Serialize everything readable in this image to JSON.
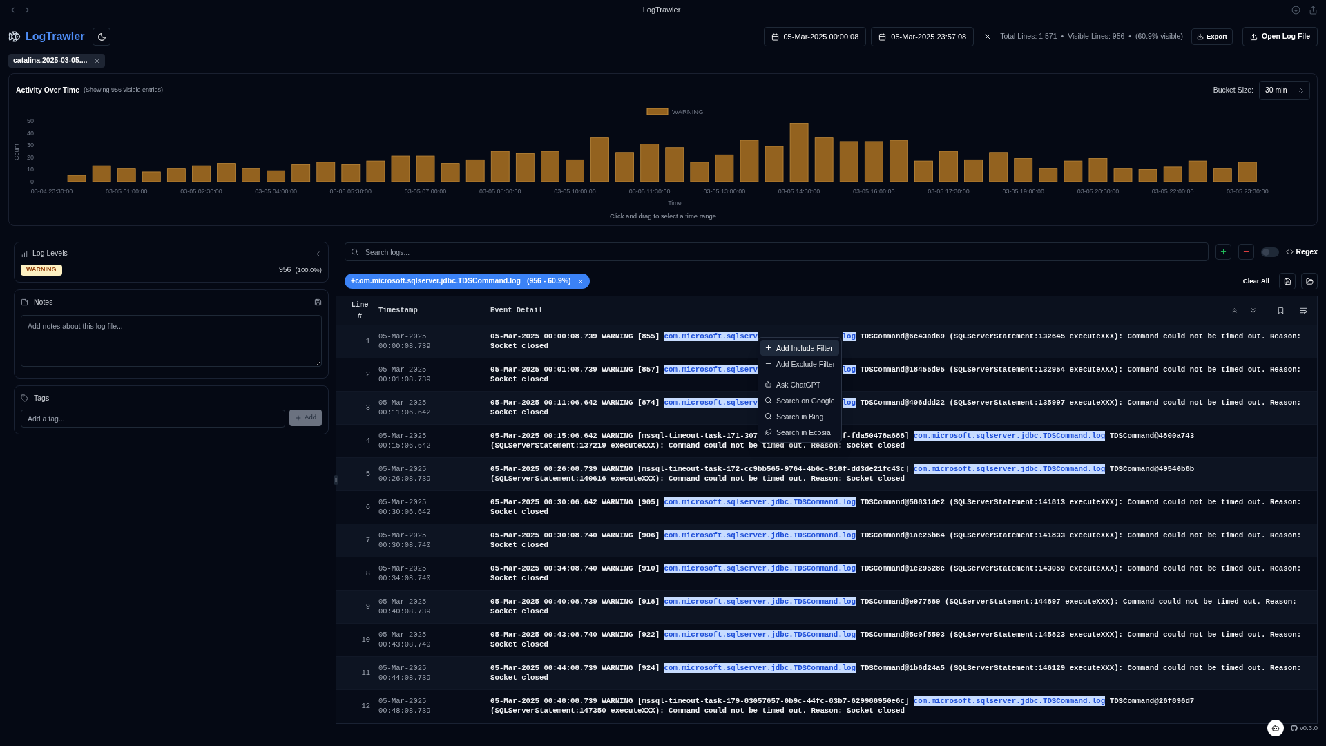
{
  "window": {
    "title": "LogTrawler"
  },
  "header": {
    "app_name": "LogTrawler",
    "start_date": "05-Mar-2025 00:00:08",
    "end_date": "05-Mar-2025 23:57:08",
    "stats": [
      "Total Lines: 1,571",
      "•",
      "Visible Lines: 956",
      "•",
      "(60.9% visible)"
    ],
    "export_label": "Export",
    "open_label": "Open Log File"
  },
  "file_tabs": [
    {
      "label": "catalina.2025-03-05....",
      "selected": true
    }
  ],
  "activity": {
    "title": "Activity Over Time",
    "subtitle": "(Showing 956 visible entries)",
    "bucket_label": "Bucket Size:",
    "bucket_value": "30 min",
    "hint": "Click and drag to select a time range",
    "chart_data": {
      "type": "bar",
      "xlabel": "Time",
      "ylabel": "Count",
      "ylim": [
        0,
        50
      ],
      "yticks": [
        0,
        10,
        20,
        30,
        40,
        50
      ],
      "categories": [
        "03-04 23:30:00",
        null,
        null,
        "03-05 01:00:00",
        null,
        null,
        "03-05 02:30:00",
        null,
        null,
        "03-05 04:00:00",
        null,
        null,
        "03-05 05:30:00",
        null,
        null,
        "03-05 07:00:00",
        null,
        null,
        "03-05 08:30:00",
        null,
        null,
        "03-05 10:00:00",
        null,
        null,
        "03-05 11:30:00",
        null,
        null,
        "03-05 13:00:00",
        null,
        null,
        "03-05 14:30:00",
        null,
        null,
        "03-05 16:00:00",
        null,
        null,
        "03-05 17:30:00",
        null,
        null,
        "03-05 19:00:00",
        null,
        null,
        "03-05 20:30:00",
        null,
        null,
        "03-05 22:00:00",
        null,
        null,
        "03-05 23:30:00"
      ],
      "series": [
        {
          "name": "WARNING",
          "color": "#93621f",
          "values": [
            0,
            5,
            13,
            11,
            8,
            11,
            13,
            15,
            11,
            9,
            14,
            16,
            14,
            17,
            21,
            21,
            15,
            18,
            25,
            23,
            25,
            18,
            36,
            24,
            31,
            28,
            16,
            22,
            34,
            29,
            48,
            36,
            33,
            33,
            34,
            17,
            25,
            18,
            24,
            19,
            11,
            17,
            19,
            11,
            10,
            12,
            17,
            11,
            16
          ]
        }
      ]
    }
  },
  "log_levels": {
    "title": "Log Levels",
    "items": [
      {
        "label": "WARNING",
        "count": "956",
        "percent": "(100.0%)"
      }
    ]
  },
  "notes": {
    "title": "Notes",
    "placeholder": "Add notes about this log file..."
  },
  "tags": {
    "title": "Tags",
    "placeholder": "Add a tag...",
    "add_label": "Add",
    "add_disabled": true
  },
  "search": {
    "placeholder": "Search logs...",
    "regex_label": "Regex",
    "regex_on": false
  },
  "filters": [
    {
      "label": "+com.microsoft.sqlserver.jdbc.TDSCommand.log",
      "count": "(956 - 60.9%)"
    }
  ],
  "clear_label": "Clear All",
  "table": {
    "columns": [
      "Line #",
      "Timestamp",
      "Event Detail"
    ],
    "rows": [
      {
        "line": "1",
        "date": "05-Mar-2025",
        "time": "00:00:08.739",
        "lines": [
          [
            {
              "kind": "plain",
              "text": "05-Mar-2025 00:00:08.739 WARNING [855] "
            },
            {
              "kind": "logger",
              "text": "com.microsoft.sqlserv"
            },
            {
              "kind": "covered"
            },
            {
              "kind": "logger",
              "text": "log"
            },
            {
              "kind": "plain",
              "text": " TDSCommand@6c43ad69 (SQLServerStatement:132645 executeXXX): Command could not be timed out. Reason:"
            }
          ],
          [
            {
              "kind": "plain",
              "text": "Socket closed"
            }
          ]
        ]
      },
      {
        "line": "2",
        "date": "05-Mar-2025",
        "time": "00:01:08.739",
        "lines": [
          [
            {
              "kind": "plain",
              "text": "05-Mar-2025 00:01:08.739 WARNING [857] "
            },
            {
              "kind": "logger",
              "text": "com.microsoft.sqlserv"
            },
            {
              "kind": "covered"
            },
            {
              "kind": "logger",
              "text": "log"
            },
            {
              "kind": "plain",
              "text": " TDSCommand@18455d95 (SQLServerStatement:132954 executeXXX): Command could not be timed out. Reason:"
            }
          ],
          [
            {
              "kind": "plain",
              "text": "Socket closed"
            }
          ]
        ]
      },
      {
        "line": "3",
        "date": "05-Mar-2025",
        "time": "00:11:06.642",
        "lines": [
          [
            {
              "kind": "plain",
              "text": "05-Mar-2025 00:11:06.642 WARNING [874] "
            },
            {
              "kind": "logger",
              "text": "com.microsoft.sqlserv"
            },
            {
              "kind": "covered"
            },
            {
              "kind": "logger",
              "text": "log"
            },
            {
              "kind": "plain",
              "text": " TDSCommand@406ddd22 (SQLServerStatement:135997 executeXXX): Command could not be timed out. Reason:"
            }
          ],
          [
            {
              "kind": "plain",
              "text": "Socket closed"
            }
          ]
        ]
      },
      {
        "line": "4",
        "date": "05-Mar-2025",
        "time": "00:15:06.642",
        "lines": [
          [
            {
              "kind": "plain",
              "text": "05-Mar-2025 00:15:06.642 WARNING [mssql-timeout-task-171-307"
            },
            {
              "kind": "covered"
            },
            {
              "kind": "plain",
              "text": "f-fda50478a688] "
            },
            {
              "kind": "logger",
              "text": "com.microsoft.sqlserver.jdbc.TDSCommand.log"
            },
            {
              "kind": "plain",
              "text": " TDSCommand@4800a743"
            }
          ],
          [
            {
              "kind": "plain",
              "text": "(SQLServerStatement:137219 executeXXX): Command could not be timed out. Reason: Socket closed"
            }
          ]
        ]
      },
      {
        "line": "5",
        "date": "05-Mar-2025",
        "time": "00:26:08.739",
        "lines": [
          [
            {
              "kind": "plain",
              "text": "05-Mar-2025 00:26:08.739 WARNING [mssql-timeout-task-172-cc9bb565-9764-4b6c-918f-dd3de21fc43c] "
            },
            {
              "kind": "logger",
              "text": "com.microsoft.sqlserver.jdbc.TDSCommand.log"
            },
            {
              "kind": "plain",
              "text": " TDSCommand@49540b6b"
            }
          ],
          [
            {
              "kind": "plain",
              "text": "(SQLServerStatement:140616 executeXXX): Command could not be timed out. Reason: Socket closed"
            }
          ]
        ]
      },
      {
        "line": "6",
        "date": "05-Mar-2025",
        "time": "00:30:06.642",
        "lines": [
          [
            {
              "kind": "plain",
              "text": "05-Mar-2025 00:30:06.642 WARNING [905] "
            },
            {
              "kind": "logger",
              "text": "com.microsoft.sqlserver.jdbc.TDSCommand.log"
            },
            {
              "kind": "plain",
              "text": " TDSCommand@58831de2 (SQLServerStatement:141813 executeXXX): Command could not be timed out. Reason:"
            }
          ],
          [
            {
              "kind": "plain",
              "text": "Socket closed"
            }
          ]
        ]
      },
      {
        "line": "7",
        "date": "05-Mar-2025",
        "time": "00:30:08.740",
        "lines": [
          [
            {
              "kind": "plain",
              "text": "05-Mar-2025 00:30:08.740 WARNING [906] "
            },
            {
              "kind": "logger",
              "text": "com.microsoft.sqlserver.jdbc.TDSCommand.log"
            },
            {
              "kind": "plain",
              "text": " TDSCommand@1ac25b64 (SQLServerStatement:141833 executeXXX): Command could not be timed out. Reason:"
            }
          ],
          [
            {
              "kind": "plain",
              "text": "Socket closed"
            }
          ]
        ]
      },
      {
        "line": "8",
        "date": "05-Mar-2025",
        "time": "00:34:08.740",
        "lines": [
          [
            {
              "kind": "plain",
              "text": "05-Mar-2025 00:34:08.740 WARNING [910] "
            },
            {
              "kind": "logger",
              "text": "com.microsoft.sqlserver.jdbc.TDSCommand.log"
            },
            {
              "kind": "plain",
              "text": " TDSCommand@1e29528c (SQLServerStatement:143059 executeXXX): Command could not be timed out. Reason:"
            }
          ],
          [
            {
              "kind": "plain",
              "text": "Socket closed"
            }
          ]
        ]
      },
      {
        "line": "9",
        "date": "05-Mar-2025",
        "time": "00:40:08.739",
        "lines": [
          [
            {
              "kind": "plain",
              "text": "05-Mar-2025 00:40:08.739 WARNING [918] "
            },
            {
              "kind": "logger",
              "text": "com.microsoft.sqlserver.jdbc.TDSCommand.log"
            },
            {
              "kind": "plain",
              "text": " TDSCommand@e977889 (SQLServerStatement:144897 executeXXX): Command could not be timed out. Reason:"
            }
          ],
          [
            {
              "kind": "plain",
              "text": "Socket closed"
            }
          ]
        ]
      },
      {
        "line": "10",
        "date": "05-Mar-2025",
        "time": "00:43:08.740",
        "lines": [
          [
            {
              "kind": "plain",
              "text": "05-Mar-2025 00:43:08.740 WARNING [922] "
            },
            {
              "kind": "logger",
              "text": "com.microsoft.sqlserver.jdbc.TDSCommand.log"
            },
            {
              "kind": "plain",
              "text": " TDSCommand@5c0f5593 (SQLServerStatement:145823 executeXXX): Command could not be timed out. Reason:"
            }
          ],
          [
            {
              "kind": "plain",
              "text": "Socket closed"
            }
          ]
        ]
      },
      {
        "line": "11",
        "date": "05-Mar-2025",
        "time": "00:44:08.739",
        "lines": [
          [
            {
              "kind": "plain",
              "text": "05-Mar-2025 00:44:08.739 WARNING [924] "
            },
            {
              "kind": "logger",
              "text": "com.microsoft.sqlserver.jdbc.TDSCommand.log"
            },
            {
              "kind": "plain",
              "text": " TDSCommand@1b6d24a5 (SQLServerStatement:146129 executeXXX): Command could not be timed out. Reason:"
            }
          ],
          [
            {
              "kind": "plain",
              "text": "Socket closed"
            }
          ]
        ]
      },
      {
        "line": "12",
        "date": "05-Mar-2025",
        "time": "00:48:08.739",
        "lines": [
          [
            {
              "kind": "plain",
              "text": "05-Mar-2025 00:48:08.739 WARNING [mssql-timeout-task-179-83057657-0b9c-44fc-83b7-629988950e6c] "
            },
            {
              "kind": "logger",
              "text": "com.microsoft.sqlserver.jdbc.TDSCommand.log"
            },
            {
              "kind": "plain",
              "text": " TDSCommand@26f896d7"
            }
          ],
          [
            {
              "kind": "plain",
              "text": "(SQLServerStatement:147350 executeXXX): Command could not be timed out. Reason: Socket closed"
            }
          ]
        ]
      }
    ]
  },
  "context_menu": {
    "items": [
      {
        "kind": "include",
        "label": "Add Include Filter",
        "selected": true
      },
      {
        "kind": "exclude",
        "label": "Add Exclude Filter",
        "selected": false
      },
      {
        "kind": "separator"
      },
      {
        "kind": "ai",
        "label": "Ask ChatGPT",
        "selected": false
      },
      {
        "kind": "search",
        "label": "Search on Google",
        "selected": false
      },
      {
        "kind": "search",
        "label": "Search in Bing",
        "selected": false
      },
      {
        "kind": "leaf",
        "label": "Search in Ecosia",
        "selected": false
      }
    ]
  },
  "footer": {
    "version": "v0.3.0"
  }
}
